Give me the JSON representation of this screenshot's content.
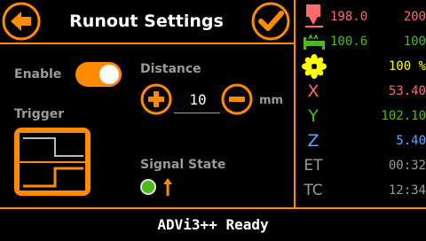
{
  "header": {
    "title": "Runout Settings",
    "back_icon": "back-arrow-icon",
    "ok_icon": "checkmark-icon"
  },
  "settings": {
    "enable_label": "Enable",
    "enable_state": true,
    "trigger_label": "Trigger",
    "distance_label": "Distance",
    "distance_value": "10",
    "distance_unit": "mm",
    "signal_state_label": "Signal State",
    "signal_state": "high"
  },
  "status": {
    "hotend_current": "198.0",
    "hotend_target": "200",
    "bed_current": "100.6",
    "bed_target": "100",
    "fan_percent": "100 %",
    "x_label": "X",
    "x_value": "53.40",
    "y_label": "Y",
    "y_value": "102.10",
    "z_label": "Z",
    "z_value": "5.40",
    "et_label": "ET",
    "et_value": "00:32",
    "tc_label": "TC",
    "tc_value": "12:34"
  },
  "status_bar": {
    "message": "ADVi3++ Ready"
  },
  "colors": {
    "accent": "#FF8C00",
    "hotend": "#FF6A6A",
    "bed": "#4CBB17",
    "fan": "#FFFF00",
    "x": "#FF6A6A",
    "y": "#4CBB17",
    "z": "#5AA9FF",
    "time": "#9a9a9a"
  }
}
